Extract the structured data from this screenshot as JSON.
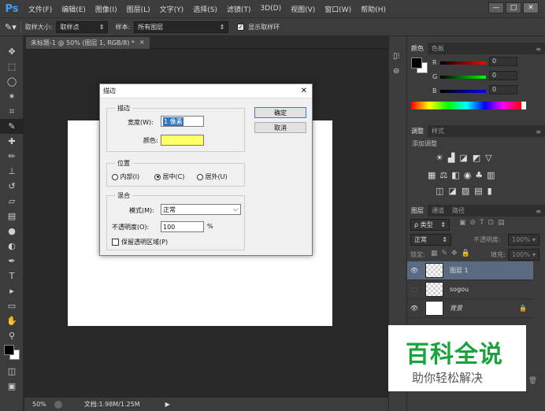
{
  "app": {
    "logo": "Ps"
  },
  "menu": [
    "文件(F)",
    "编辑(E)",
    "图像(I)",
    "图层(L)",
    "文字(Y)",
    "选择(S)",
    "滤镜(T)",
    "3D(D)",
    "视图(V)",
    "窗口(W)",
    "帮助(H)"
  ],
  "window_controls": {
    "minimize": "—",
    "maximize": "□",
    "close": "✕"
  },
  "options": {
    "sample_size_label": "取样大小:",
    "sample_size_value": "取样点",
    "sample_label": "样本:",
    "sample_value": "所有图层",
    "show_ring_label": "显示取样环",
    "show_ring_checked": true
  },
  "document": {
    "tab_title": "未标题-1 @ 50% (图层 1, RGB/8) *",
    "tab_close": "×"
  },
  "status": {
    "zoom": "50%",
    "doc_info": "文档:1.98M/1.25M"
  },
  "dialog": {
    "title": "描边",
    "close": "✕",
    "stroke_group": "描边",
    "width_label": "宽度(W):",
    "width_value": "1 像素",
    "color_label": "颜色:",
    "color_value": "#ffff66",
    "ok": "确定",
    "cancel": "取消",
    "position_group": "位置",
    "positions": [
      {
        "label": "内部(I)",
        "checked": false
      },
      {
        "label": "居中(C)",
        "checked": true
      },
      {
        "label": "居外(U)",
        "checked": false
      }
    ],
    "blend_group": "混合",
    "mode_label": "模式(M):",
    "mode_value": "正常",
    "opacity_label": "不透明度(O):",
    "opacity_value": "100",
    "opacity_unit": "%",
    "preserve_label": "保留透明区域(P)",
    "preserve_checked": false
  },
  "color_panel": {
    "tabs": [
      "颜色",
      "色板"
    ],
    "channels": [
      {
        "name": "R",
        "value": "0"
      },
      {
        "name": "G",
        "value": "0"
      },
      {
        "name": "B",
        "value": "0"
      }
    ]
  },
  "adjust_panel": {
    "tabs": [
      "调整",
      "样式"
    ],
    "add_label": "添加调整"
  },
  "layers_panel": {
    "tabs": [
      "图层",
      "通道",
      "路径"
    ],
    "filter_label": "ρ 类型",
    "blend_mode": "正常",
    "opacity_label": "不透明度:",
    "opacity_value": "100%",
    "lock_label": "锁定:",
    "fill_label": "填充:",
    "fill_value": "100%",
    "layers": [
      {
        "name": "图层 1",
        "visible": true,
        "selected": true
      },
      {
        "name": "sogou",
        "visible": false,
        "selected": false
      },
      {
        "name": "背景",
        "visible": true,
        "selected": false
      }
    ]
  },
  "watermark": {
    "title": "百科全说",
    "subtitle": "助你轻松解决",
    "title_color": "#1aa33a"
  },
  "colors": {
    "foreground": "#000000",
    "background": "#ffffff"
  }
}
